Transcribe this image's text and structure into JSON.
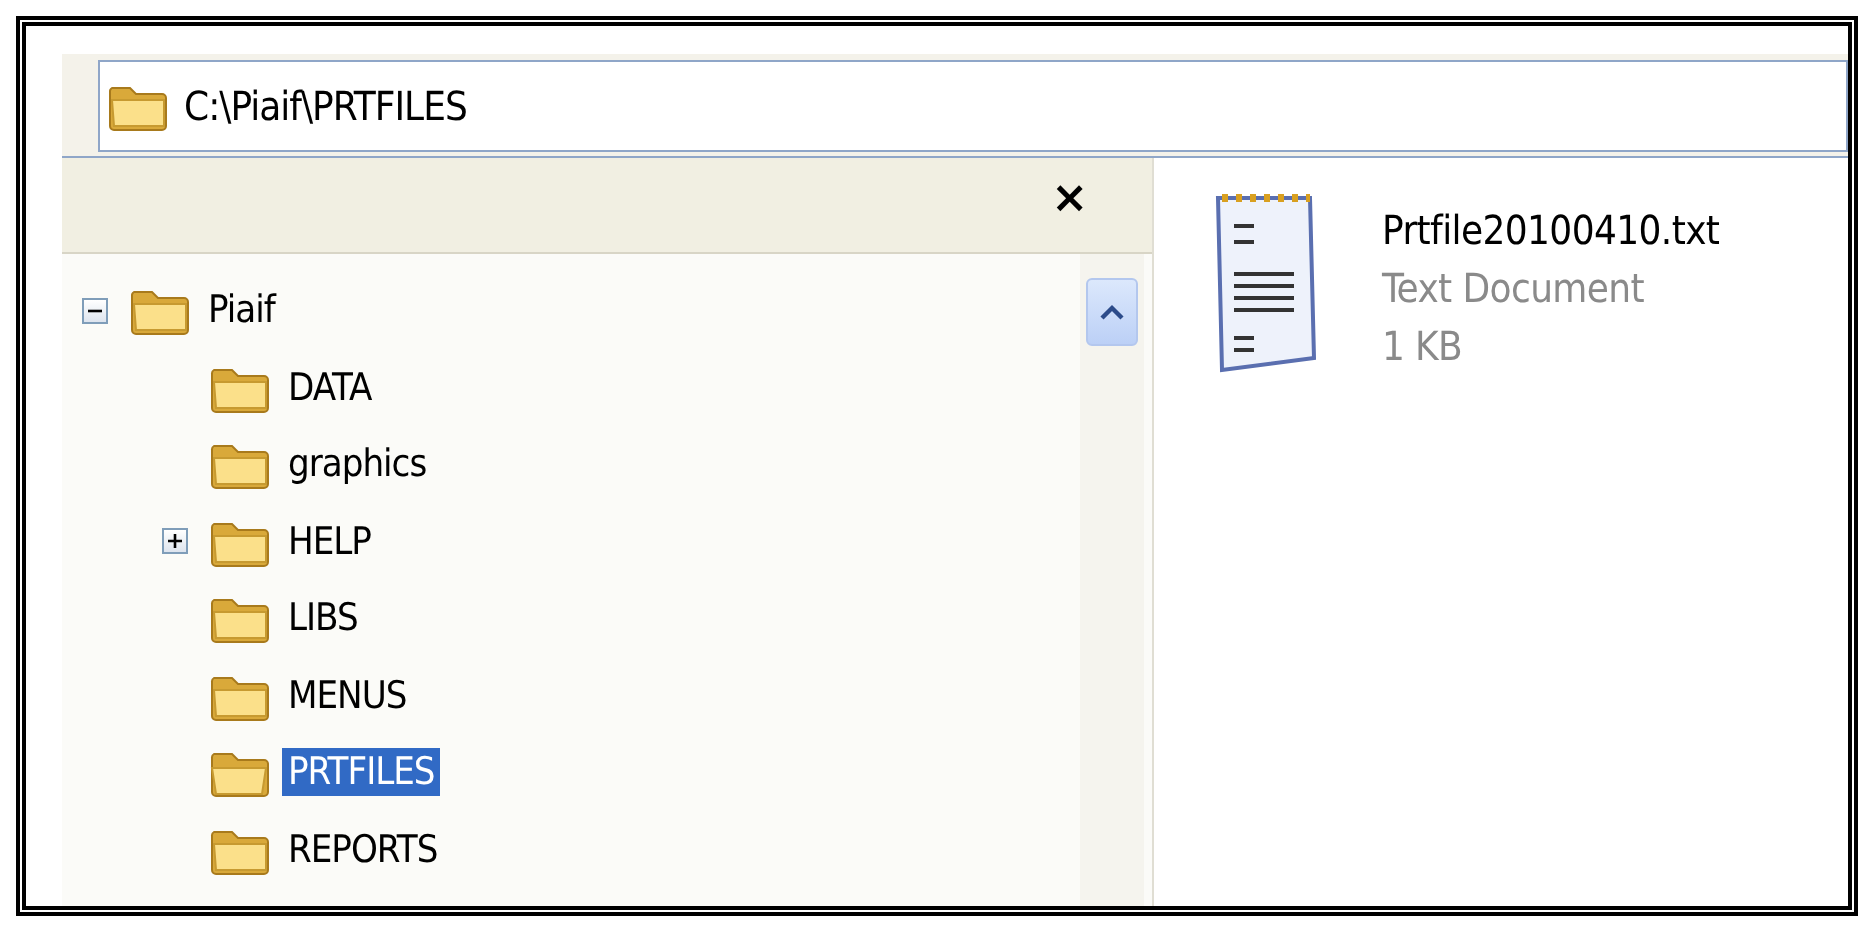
{
  "address_bar": {
    "value": "C:\\Piaif\\PRTFILES"
  },
  "folders_pane": {
    "close_label": "×"
  },
  "tree": [
    {
      "label": "Piaif",
      "expanded": true,
      "selected": false,
      "children": [
        {
          "label": "DATA",
          "selected": false
        },
        {
          "label": "graphics",
          "selected": false
        },
        {
          "label": "HELP",
          "expanded": false,
          "selected": false
        },
        {
          "label": "LIBS",
          "selected": false
        },
        {
          "label": "MENUS",
          "selected": false
        },
        {
          "label": "PRTFILES",
          "selected": true
        },
        {
          "label": "REPORTS",
          "selected": false
        }
      ]
    }
  ],
  "files": [
    {
      "name": "Prtfile20100410.txt",
      "type": "Text Document",
      "size": "1 KB"
    }
  ]
}
